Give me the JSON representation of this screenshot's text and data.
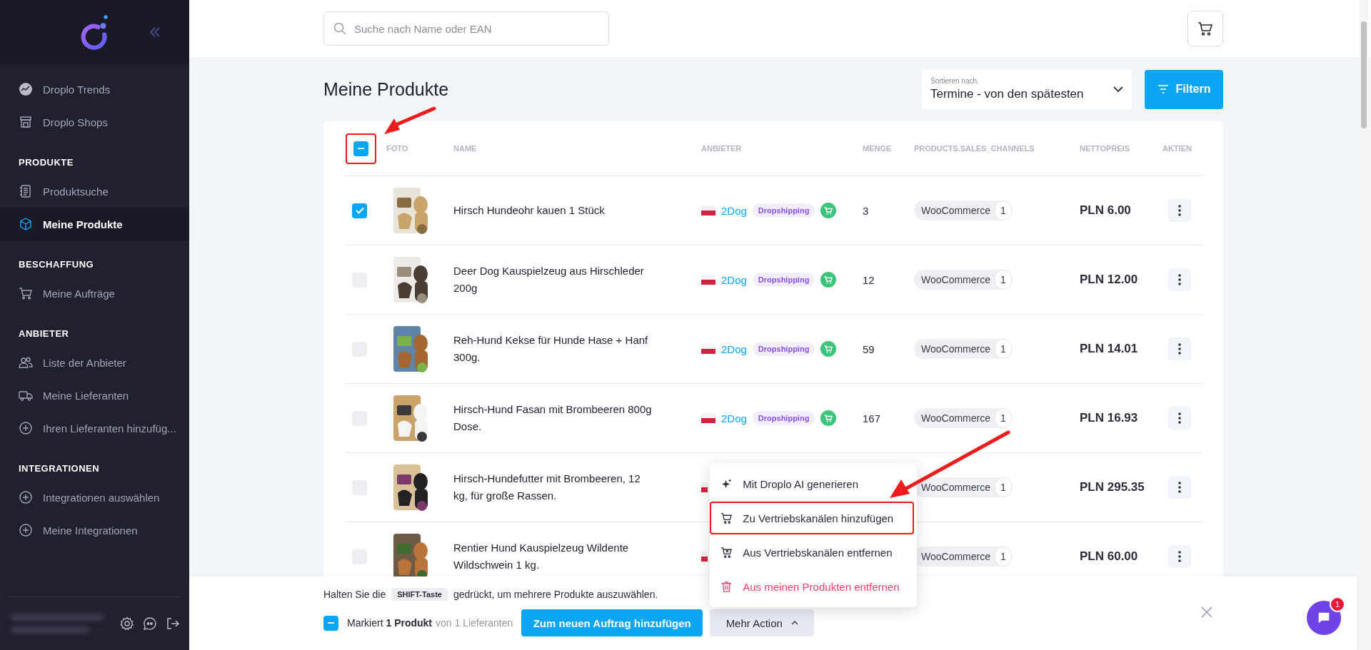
{
  "sidebar": {
    "top_items": [
      {
        "label": "Droplo Trends",
        "kind": "trends",
        "selected": false
      },
      {
        "label": "Droplo Shops",
        "kind": "shop",
        "selected": false
      }
    ],
    "sections": [
      {
        "heading": "PRODUKTE",
        "items": [
          {
            "label": "Produktsuche",
            "kind": "list",
            "selected": false
          },
          {
            "label": "Meine Produkte",
            "kind": "box",
            "selected": true
          }
        ]
      },
      {
        "heading": "BESCHAFFUNG",
        "items": [
          {
            "label": "Meine Aufträge",
            "kind": "cart",
            "selected": false
          }
        ]
      },
      {
        "heading": "ANBIETER",
        "items": [
          {
            "label": "Liste der Anbieter",
            "kind": "people",
            "selected": false
          },
          {
            "label": "Meine Lieferanten",
            "kind": "truck",
            "selected": false
          },
          {
            "label": "Ihren Lieferanten hinzufüg...",
            "kind": "plus",
            "selected": false
          }
        ]
      },
      {
        "heading": "INTEGRATIONEN",
        "items": [
          {
            "label": "Integrationen auswählen",
            "kind": "plus",
            "selected": false
          },
          {
            "label": "Meine Integrationen",
            "kind": "plus",
            "selected": false
          }
        ]
      }
    ]
  },
  "search": {
    "placeholder": "Suche nach Name oder EAN"
  },
  "page_title": "Meine Produkte",
  "sort": {
    "label": "Sortieren nach.",
    "value": "Termine - von den spätesten"
  },
  "filter_button": "Filtern",
  "table": {
    "select_all": {
      "indeterminate": true,
      "annotated": true
    },
    "columns": [
      "FOTO",
      "NAME",
      "ANBIETER",
      "MENGE",
      "PRODUCTS.SALES_CHANNELS",
      "NETTOPREIS",
      "AKTIEN"
    ],
    "rows": [
      {
        "checked": true,
        "name": "Hirsch Hundeohr kauen 1 Stück",
        "vendor": "2Dog",
        "tag": "Dropshipping",
        "quantity": "3",
        "channel": "WooCommerce",
        "channel_count": "1",
        "price": "PLN 6.00"
      },
      {
        "checked": false,
        "name": "Deer Dog Kauspielzeug aus Hirschleder 200g",
        "vendor": "2Dog",
        "tag": "Dropshipping",
        "quantity": "12",
        "channel": "WooCommerce",
        "channel_count": "1",
        "price": "PLN 12.00"
      },
      {
        "checked": false,
        "name": "Reh-Hund Kekse für Hunde Hase + Hanf 300g.",
        "vendor": "2Dog",
        "tag": "Dropshipping",
        "quantity": "59",
        "channel": "WooCommerce",
        "channel_count": "1",
        "price": "PLN 14.01"
      },
      {
        "checked": false,
        "name": "Hirsch-Hund Fasan mit Brombeeren 800g Dose.",
        "vendor": "2Dog",
        "tag": "Dropshipping",
        "quantity": "167",
        "channel": "WooCommerce",
        "channel_count": "1",
        "price": "PLN 16.93"
      },
      {
        "checked": false,
        "name": "Hirsch-Hundefutter mit Brombeeren, 12 kg, für große Rassen.",
        "channel": "WooCommerce",
        "channel_count": "1",
        "price": "PLN 295.35"
      },
      {
        "checked": false,
        "name": "Rentier Hund Kauspielzeug Wildente Wildschwein 1 kg.",
        "channel": "WooCommerce",
        "channel_count": "1",
        "price": "PLN 60.00"
      }
    ]
  },
  "bottom_bar": {
    "hint_before": "Halten Sie die",
    "hint_key": "SHIFT-Taste",
    "hint_after": "gedrückt, um mehrere Produkte auszuwählen.",
    "selection_indeterminate": true,
    "selection": "Markiert **1 Produkt**",
    "selection_source": "von 1 Lieferanten",
    "primary_button": "Zum neuen Auftrag hinzufügen",
    "more_button": "Mehr Action",
    "menu": [
      {
        "label": "Mit Droplo AI generieren",
        "kind": "sparkle",
        "danger": false,
        "annotated": false
      },
      {
        "label": "Zu Vertriebskanälen hinzufügen",
        "kind": "cart",
        "danger": false,
        "annotated": true
      },
      {
        "label": "Aus Vertriebskanälen entfernen",
        "kind": "cart-remove",
        "danger": false,
        "annotated": false
      },
      {
        "label": "Aus meinen Produkten entfernen",
        "kind": "trash",
        "danger": true,
        "annotated": false
      }
    ]
  },
  "chat": {
    "badge": "1"
  }
}
